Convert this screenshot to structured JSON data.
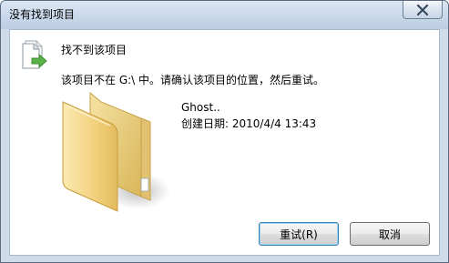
{
  "window": {
    "title": "没有找到项目"
  },
  "dialog": {
    "heading": "找不到该项目",
    "message": "该项目不在 G:\\ 中。请确认该项目的位置，然后重试。",
    "item": {
      "name": "Ghost..",
      "created": "创建日期: 2010/4/4 13:43",
      "icon": "folder-icon"
    },
    "header_icon": "file-moved-icon"
  },
  "buttons": {
    "retry_label": "重试(R)",
    "cancel_label": "取消"
  },
  "colors": {
    "titlebar": "#c9d8ea",
    "frame_border": "#5b6a80",
    "content_bg": "#ffffff",
    "folder_yellow": "#f0d27a",
    "arrow_green": "#5bb24a"
  }
}
